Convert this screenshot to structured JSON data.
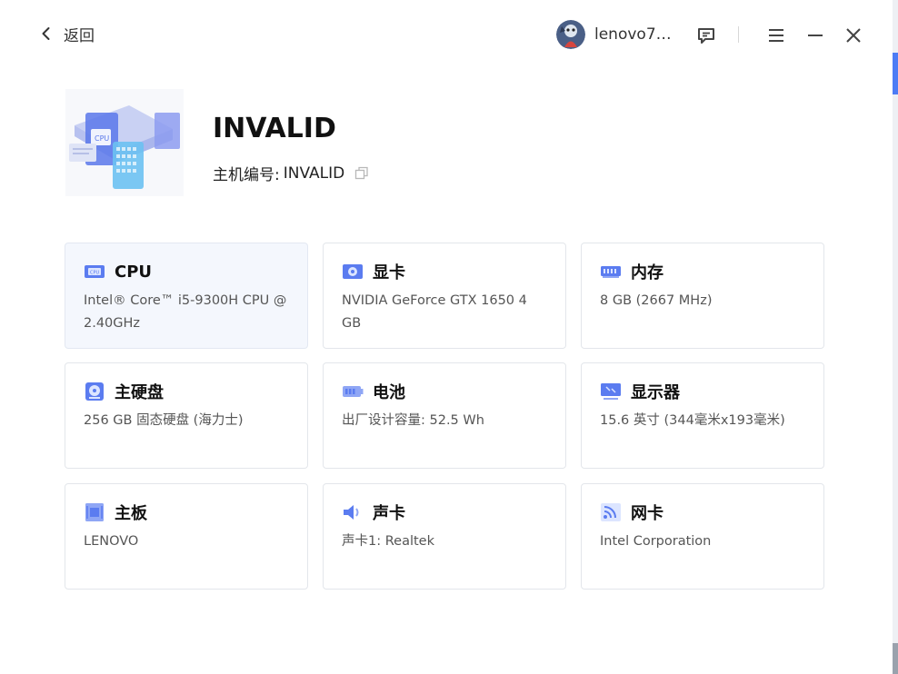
{
  "topbar": {
    "back_label": "返回",
    "username": "lenovo7…"
  },
  "device": {
    "name": "INVALID",
    "host_label": "主机编号:",
    "host_value": "INVALID"
  },
  "colors": {
    "accent": "#4d7cf5",
    "active_card": "#f4f7fd"
  },
  "cards": [
    {
      "icon": "cpu-icon",
      "title": "CPU",
      "value": "Intel® Core™ i5-9300H CPU @ 2.40GHz"
    },
    {
      "icon": "gpu-icon",
      "title": "显卡",
      "value": "NVIDIA GeForce GTX 1650 4 GB"
    },
    {
      "icon": "memory-icon",
      "title": "内存",
      "value": "8 GB (2667 MHz)"
    },
    {
      "icon": "disk-icon",
      "title": "主硬盘",
      "value": "256 GB 固态硬盘 (海力士)"
    },
    {
      "icon": "battery-icon",
      "title": "电池",
      "value": "出厂设计容量: 52.5 Wh"
    },
    {
      "icon": "monitor-icon",
      "title": "显示器",
      "value": "15.6 英寸 (344毫米x193毫米)"
    },
    {
      "icon": "motherboard-icon",
      "title": "主板",
      "value": "LENOVO"
    },
    {
      "icon": "speaker-icon",
      "title": "声卡",
      "value": "声卡1: Realtek"
    },
    {
      "icon": "wifi-icon",
      "title": "网卡",
      "value": "Intel Corporation"
    }
  ]
}
